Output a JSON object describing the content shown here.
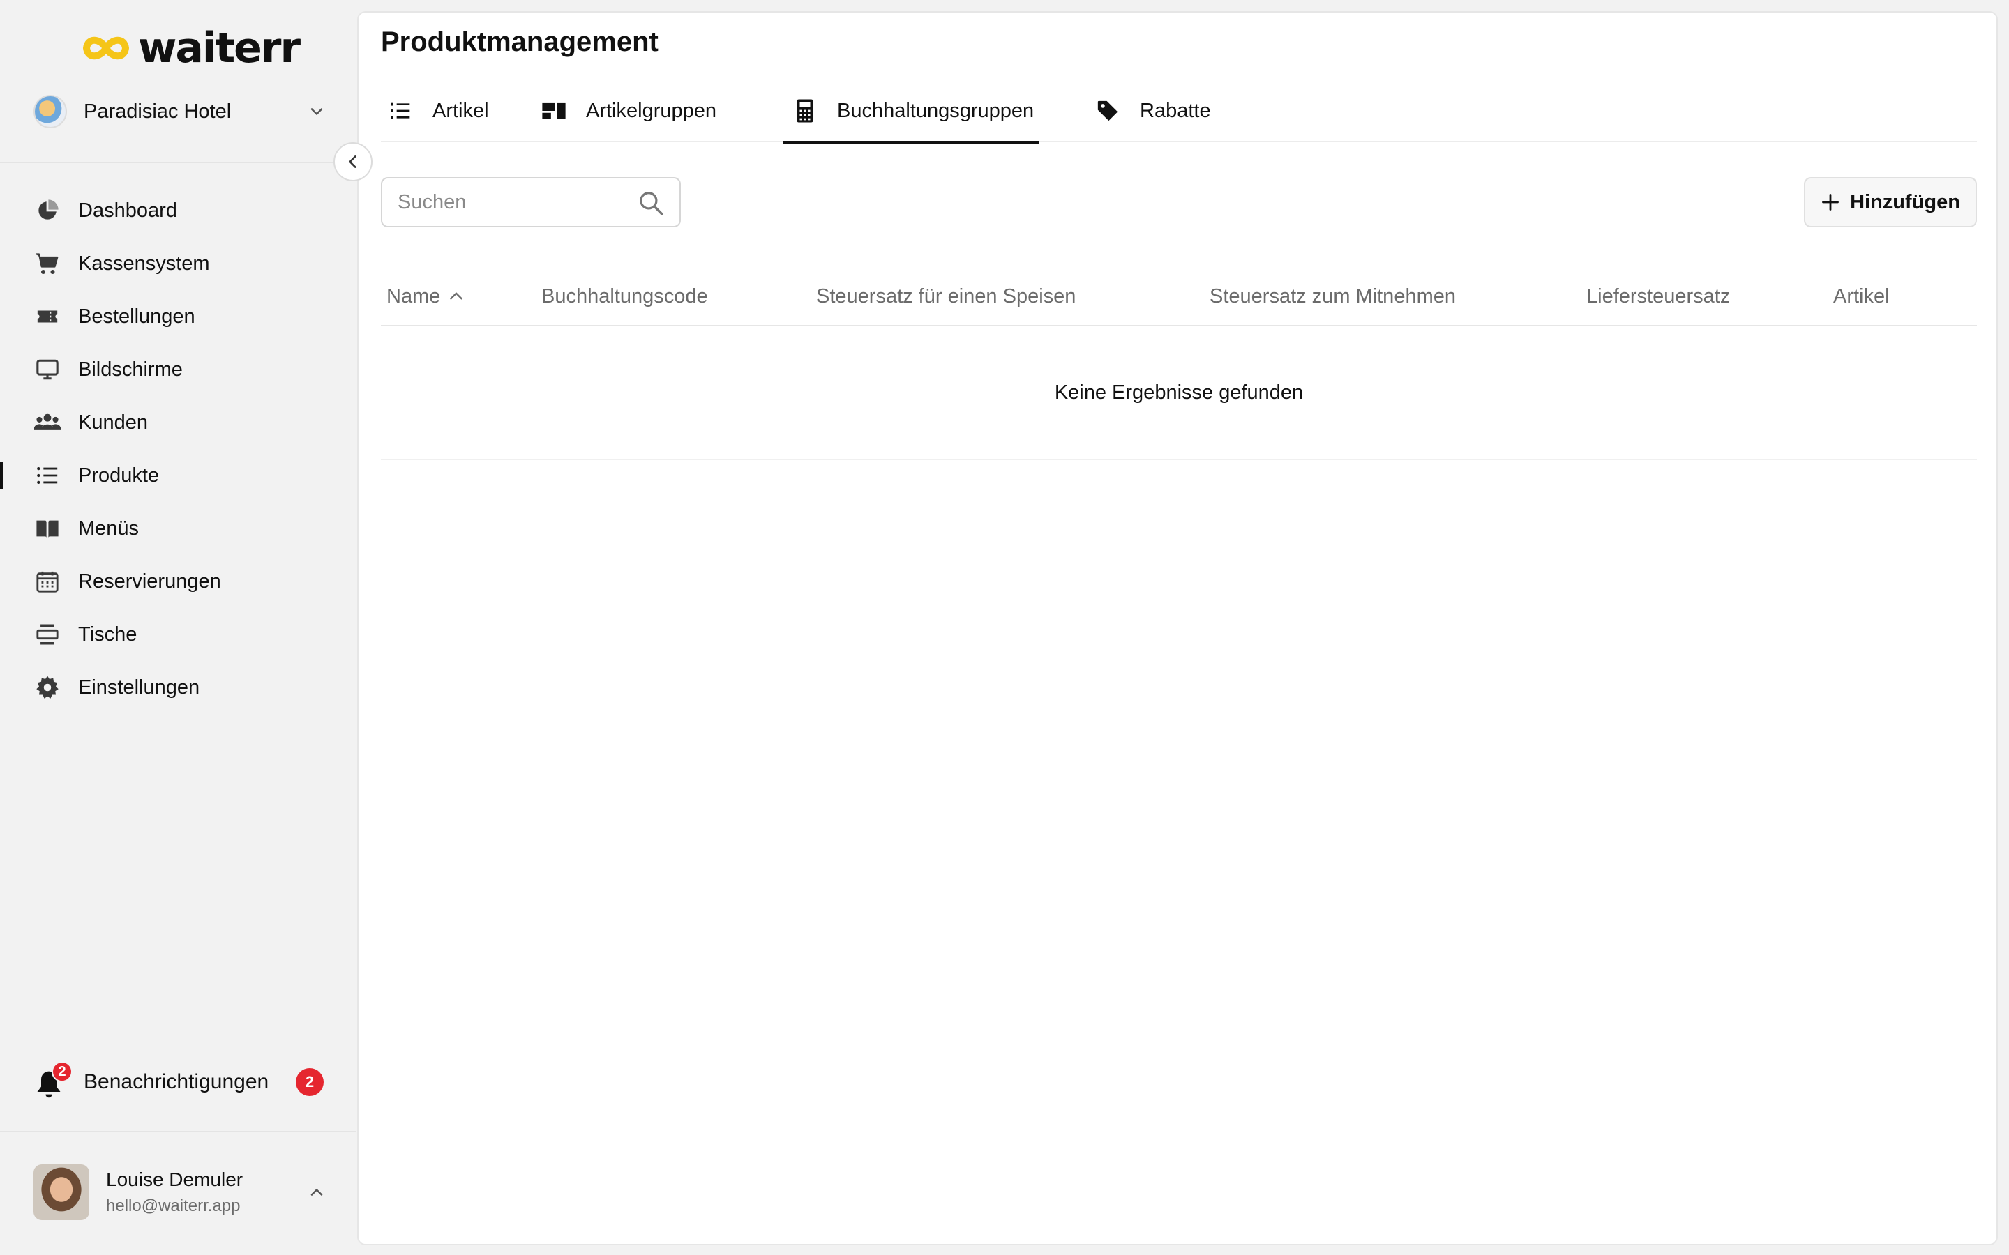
{
  "brand": {
    "logo_text": "waiterr",
    "accent": "#F5C518"
  },
  "venue": {
    "name": "Paradisiac Hotel",
    "icon": "hotel-avatar"
  },
  "sidebar": {
    "items": [
      {
        "label": "Dashboard",
        "icon": "pie-chart-icon",
        "active": false
      },
      {
        "label": "Kassensystem",
        "icon": "cart-icon",
        "active": false
      },
      {
        "label": "Bestellungen",
        "icon": "ticket-icon",
        "active": false
      },
      {
        "label": "Bildschirme",
        "icon": "monitor-icon",
        "active": false
      },
      {
        "label": "Kunden",
        "icon": "users-icon",
        "active": false
      },
      {
        "label": "Produkte",
        "icon": "list-icon",
        "active": true
      },
      {
        "label": "Menüs",
        "icon": "book-icon",
        "active": false
      },
      {
        "label": "Reservierungen",
        "icon": "calendar-icon",
        "active": false
      },
      {
        "label": "Tische",
        "icon": "table-icon",
        "active": false
      },
      {
        "label": "Einstellungen",
        "icon": "gear-icon",
        "active": false
      }
    ],
    "notifications": {
      "label": "Benachrichtigungen",
      "count": "2",
      "badge_color": "#E5262F"
    },
    "user": {
      "name": "Louise Demuler",
      "email": "hello@waiterr.app"
    }
  },
  "main": {
    "title": "Produktmanagement",
    "tabs": [
      {
        "label": "Artikel",
        "icon": "list-icon",
        "active": false
      },
      {
        "label": "Artikelgruppen",
        "icon": "groups-icon",
        "active": false
      },
      {
        "label": "Buchhaltungsgruppen",
        "icon": "calculator-icon",
        "active": true
      },
      {
        "label": "Rabatte",
        "icon": "tag-icon",
        "active": false
      }
    ],
    "search": {
      "placeholder": "Suchen",
      "value": ""
    },
    "add_button": {
      "label": "Hinzufügen"
    },
    "table": {
      "columns": [
        {
          "label": "Name",
          "sorted": "asc"
        },
        {
          "label": "Buchhaltungscode"
        },
        {
          "label": "Steuersatz für einen Speisen"
        },
        {
          "label": "Steuersatz zum Mitnehmen"
        },
        {
          "label": "Liefersteuersatz"
        },
        {
          "label": "Artikel"
        }
      ],
      "rows": [],
      "empty_message": "Keine Ergebnisse gefunden"
    }
  }
}
